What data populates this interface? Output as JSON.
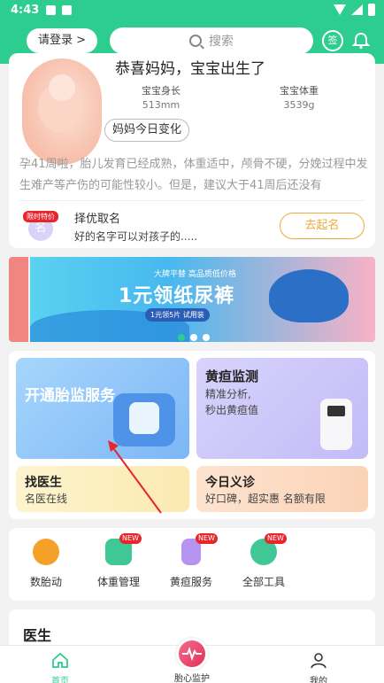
{
  "status_bar": {
    "time": "4:43"
  },
  "header": {
    "login_label": "请登录 >",
    "search_placeholder": "搜索",
    "sign_label": "签"
  },
  "pregnancy_card": {
    "congrats": "恭喜妈妈，宝宝出生了",
    "length_label": "宝宝身长",
    "length_value": "513mm",
    "weight_label": "宝宝体重",
    "weight_value": "3539g",
    "mama_button": "妈妈今日变化",
    "description": "孕41周啦，胎儿发育已经成熟，体重适中，颅骨不硬，分娩过程中发生难产等产伤的可能性较小。但是，建议大于41周后还没有"
  },
  "naming_card": {
    "avatar_text": "名",
    "promo_tag": "限时特价",
    "title": "择优取名",
    "desc": "好的名字可以对孩子的.....",
    "button": "去起名"
  },
  "banner": {
    "small_text": "大牌平替  高品质低价格",
    "headline": "1元领纸尿裤",
    "chip": "1元领5片 试用装"
  },
  "services": {
    "fetal": {
      "title": "开通胎监服务"
    },
    "jaundice": {
      "title": "黄疸监测",
      "sub1": "精准分析,",
      "sub2": "秒出黄疸值"
    },
    "doctor": {
      "title": "找医生",
      "sub": "名医在线"
    },
    "clinic": {
      "title": "今日义诊",
      "sub": "好口碑，超实惠 名额有限"
    }
  },
  "tools": [
    {
      "label": "数胎动",
      "icon": "stopwatch-icon",
      "badge": ""
    },
    {
      "label": "体重管理",
      "icon": "weight-icon",
      "badge": "NEW"
    },
    {
      "label": "黄疸服务",
      "icon": "jaundice-meter-icon",
      "badge": "NEW"
    },
    {
      "label": "全部工具",
      "icon": "grid-tools-icon",
      "badge": "NEW"
    }
  ],
  "doctor_section": {
    "title": "医生"
  },
  "tabbar": {
    "home": "首页",
    "fetal_monitor": "胎心监护",
    "mine": "我的"
  },
  "colors": {
    "accent": "#2dcc8f",
    "orange": "#f1a93b",
    "red": "#e8242c"
  }
}
